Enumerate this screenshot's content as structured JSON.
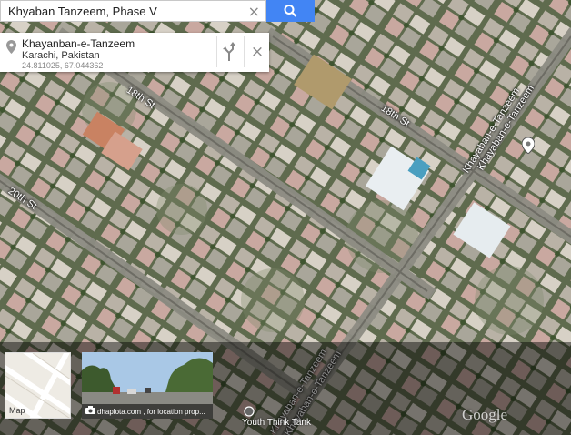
{
  "search": {
    "query": "Khyaban Tanzeem, Phase V",
    "clear_icon": "×",
    "search_icon": "search-icon",
    "button_color": "#4285f4"
  },
  "result": {
    "name": "Khayanban-e-Tanzeem",
    "region": "Karachi, Pakistan",
    "coordinates": "24.811025, 67.044362",
    "directions_icon": "directions-icon",
    "close_icon": "×"
  },
  "map": {
    "view": "satellite",
    "road_labels": [
      "18th St",
      "18th St",
      "20th St",
      "Khayaban-e-Tanzeem",
      "Khayaban-e-Tanzeem",
      "Khayaban-e-Tanzeem",
      "Khayaban-e-Tanzeem"
    ],
    "poi_label": "Youth Think Tank",
    "attribution": "Google"
  },
  "thumbnails": {
    "map_label": "Map",
    "photo_caption": "dhaplota.com , for location prop..."
  }
}
